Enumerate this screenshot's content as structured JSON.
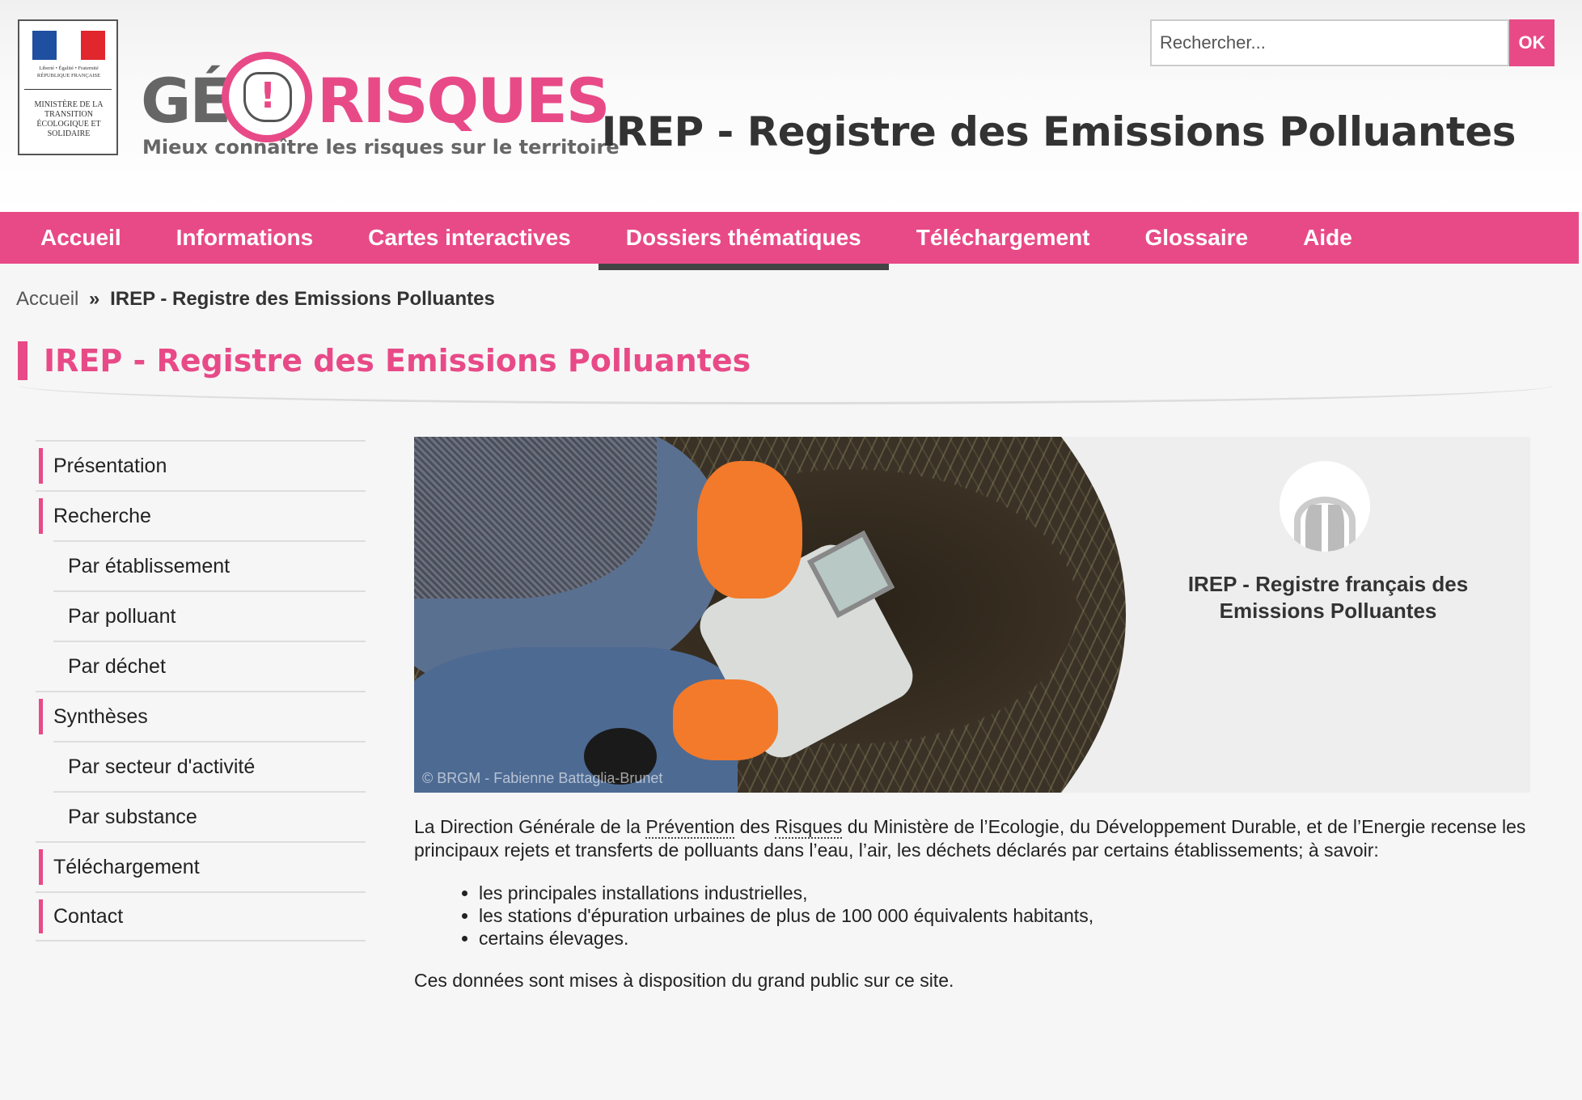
{
  "header": {
    "ministry_motto": "Liberté • Égalité • Fraternité RÉPUBLIQUE FRANÇAISE",
    "ministry_name": "Ministère de la Transition Écologique et Solidaire",
    "logo_ge": "GÉ",
    "logo_excl": "!",
    "logo_risques": "RISQUES",
    "logo_tagline": "Mieux connaître les risques sur le territoire",
    "search_placeholder": "Rechercher...",
    "search_button": "OK",
    "site_title": "IREP - Registre des Emissions Polluantes"
  },
  "nav": {
    "items": [
      {
        "label": "Accueil"
      },
      {
        "label": "Informations"
      },
      {
        "label": "Cartes interactives"
      },
      {
        "label": "Dossiers thématiques",
        "active": true
      },
      {
        "label": "Téléchargement"
      },
      {
        "label": "Glossaire"
      },
      {
        "label": "Aide"
      }
    ]
  },
  "breadcrumb": {
    "home": "Accueil",
    "separator": "»",
    "current": "IREP - Registre des Emissions Polluantes"
  },
  "page_title": "IREP - Registre des Emissions Polluantes",
  "sidebar": {
    "items": [
      {
        "label": "Présentation",
        "level": 1
      },
      {
        "label": "Recherche",
        "level": 1
      },
      {
        "label": "Par établissement",
        "level": 2
      },
      {
        "label": "Par polluant",
        "level": 2
      },
      {
        "label": "Par déchet",
        "level": 2
      },
      {
        "label": "Synthèses",
        "level": 1
      },
      {
        "label": "Par secteur d'activité",
        "level": 2
      },
      {
        "label": "Par substance",
        "level": 2
      },
      {
        "label": "Téléchargement",
        "level": 1
      },
      {
        "label": "Contact",
        "level": 1
      }
    ]
  },
  "banner": {
    "photo_credit": "© BRGM - Fabienne Battaglia-Brunet",
    "heading_line1": "IREP - Registre français des",
    "heading_line2": "Emissions Polluantes"
  },
  "content": {
    "intro_1": "La Direction Générale de la ",
    "intro_abbr1": "Prévention",
    "intro_2": " des ",
    "intro_abbr2": "Risques",
    "intro_3": " du Ministère de l’Ecologie, du Développement Durable, et de l’Energie recense les principaux rejets et transferts de polluants dans l’eau, l’air, les déchets déclarés par certains établissements; à savoir:",
    "bullets": [
      "les principales installations industrielles,",
      "les stations d'épuration urbaines de plus de 100 000 équivalents habitants,",
      "certains élevages."
    ],
    "closing": "Ces données sont mises à disposition du grand public sur ce site."
  },
  "colors": {
    "accent": "#e84a87",
    "nav_active_underline": "#444444",
    "text": "#222222"
  }
}
